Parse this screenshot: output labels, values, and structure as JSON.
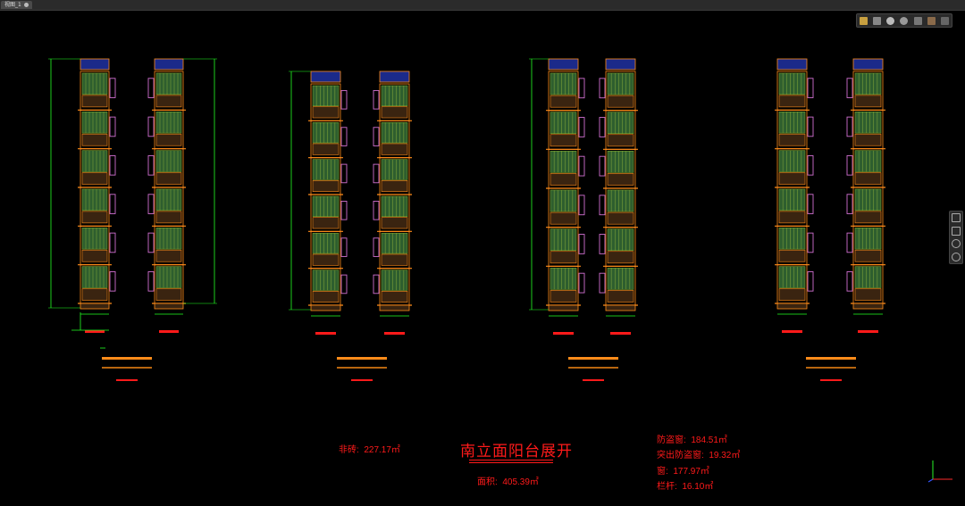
{
  "window": {
    "tab_label": "视图_1"
  },
  "toolbar": {
    "icons": [
      "layers-icon",
      "grid-icon",
      "orbit-icon",
      "sun-icon",
      "settings-icon",
      "box-icon",
      "copy-icon"
    ]
  },
  "sidetools": {
    "icons": [
      "pan-icon",
      "zoom-icon",
      "rotate-icon",
      "fit-icon"
    ]
  },
  "summary": {
    "title": "南立面阳台展开",
    "tile_label": "非砖:",
    "tile_value": "227.17㎡",
    "area_label": "面积:",
    "area_value": "405.39㎡",
    "anti_theft_label": "防盗窗:",
    "anti_theft_value": "184.51㎡",
    "protruding_label": "突出防盗窗:",
    "protruding_value": "19.32㎡",
    "window_label": "窗:",
    "window_value": "177.97㎡",
    "railing_label": "栏杆:",
    "railing_value": "16.10㎡"
  },
  "colors": {
    "background": "#000000",
    "frame": "#ff8c1a",
    "window_fill": "#2e5e2e",
    "window_blue": "#1b2a8a",
    "dimension": "#22ff22",
    "annotation": "#ff1a1a",
    "pink": "#d070d0"
  }
}
